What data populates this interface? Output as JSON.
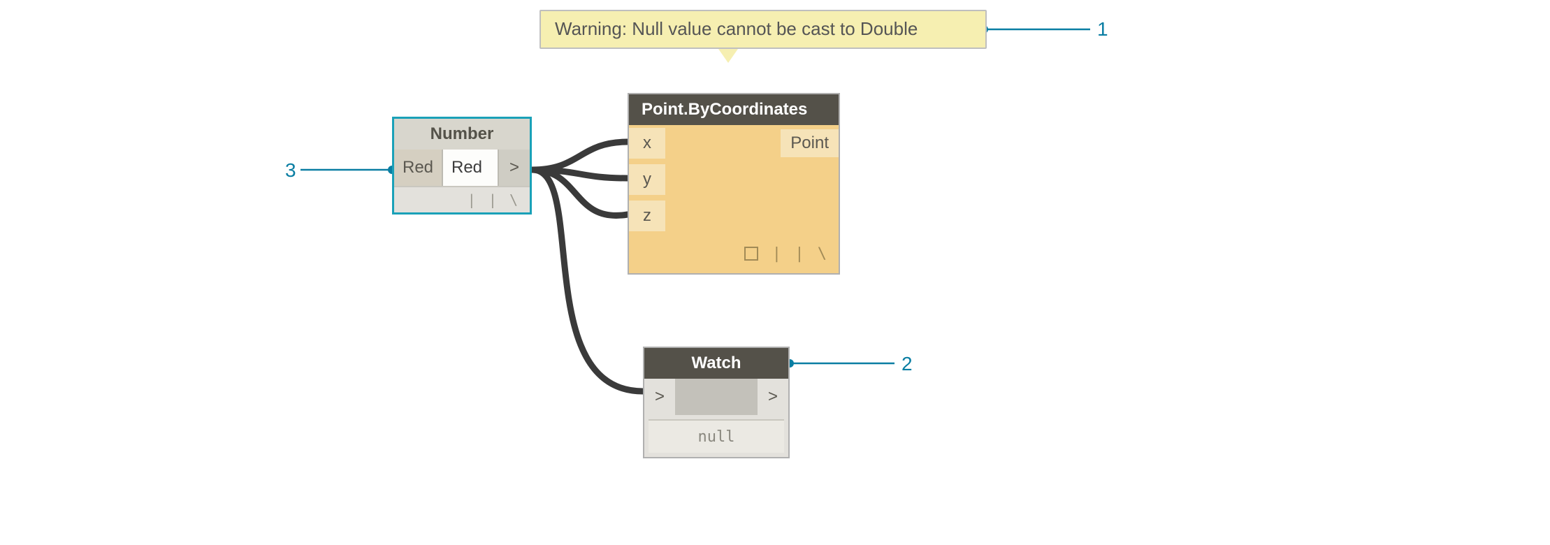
{
  "warning": {
    "text": "Warning: Null value cannot be cast to Double"
  },
  "number_node": {
    "title": "Number",
    "port_label": "Red",
    "value": "Red",
    "out_label": ">",
    "lacing": "| | \\"
  },
  "point_node": {
    "title": "Point.ByCoordinates",
    "ports": {
      "x": "x",
      "y": "y",
      "z": "z"
    },
    "out_label": "Point",
    "lacing": "| | \\"
  },
  "watch_node": {
    "title": "Watch",
    "in_label": ">",
    "out_label": ">",
    "value": "null"
  },
  "callouts": {
    "one": "1",
    "two": "2",
    "three": "3"
  }
}
